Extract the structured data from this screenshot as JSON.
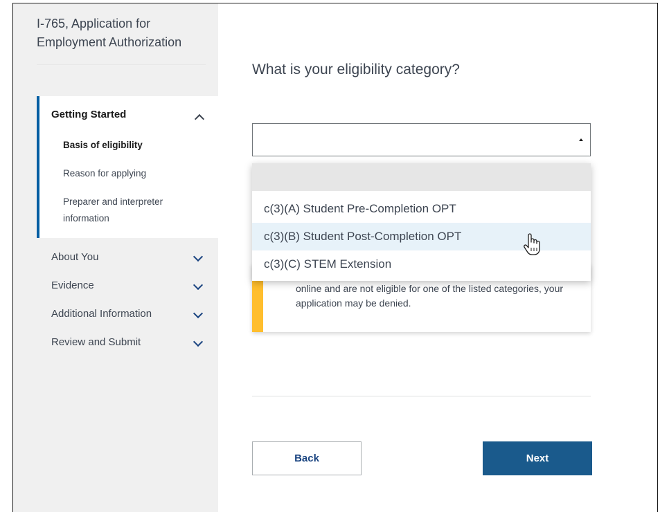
{
  "form": {
    "title": "I-765, Application for Employment Authorization"
  },
  "sidebar": {
    "open_section": {
      "label": "Getting Started",
      "items": [
        {
          "label": "Basis of eligibility",
          "active": true
        },
        {
          "label": "Reason for applying",
          "active": false
        },
        {
          "label": "Preparer and interpreter information",
          "active": false
        }
      ]
    },
    "sections": [
      {
        "label": "About You"
      },
      {
        "label": "Evidence"
      },
      {
        "label": "Additional Information"
      },
      {
        "label": "Review and Submit"
      }
    ]
  },
  "main": {
    "question": "What is your eligibility category?",
    "select": {
      "value": "",
      "options": [
        "",
        "c(3)(A) Student Pre-Completion OPT",
        "c(3)(B) Student Post-Completion OPT",
        "c(3)(C) STEM Extension"
      ],
      "hovered_option": "c(3)(B) Student Post-Completion OPT"
    },
    "alert": {
      "visible_text": "online and are not eligible for one of the listed categories, your application may be denied."
    },
    "buttons": {
      "back": "Back",
      "next": "Next"
    }
  },
  "colors": {
    "primary": "#1a5a8c",
    "accent_border": "#005ea2",
    "warning": "#ffbe2e",
    "hover": "#e7f2f9",
    "sidebar_bg": "#f0f0f0"
  }
}
